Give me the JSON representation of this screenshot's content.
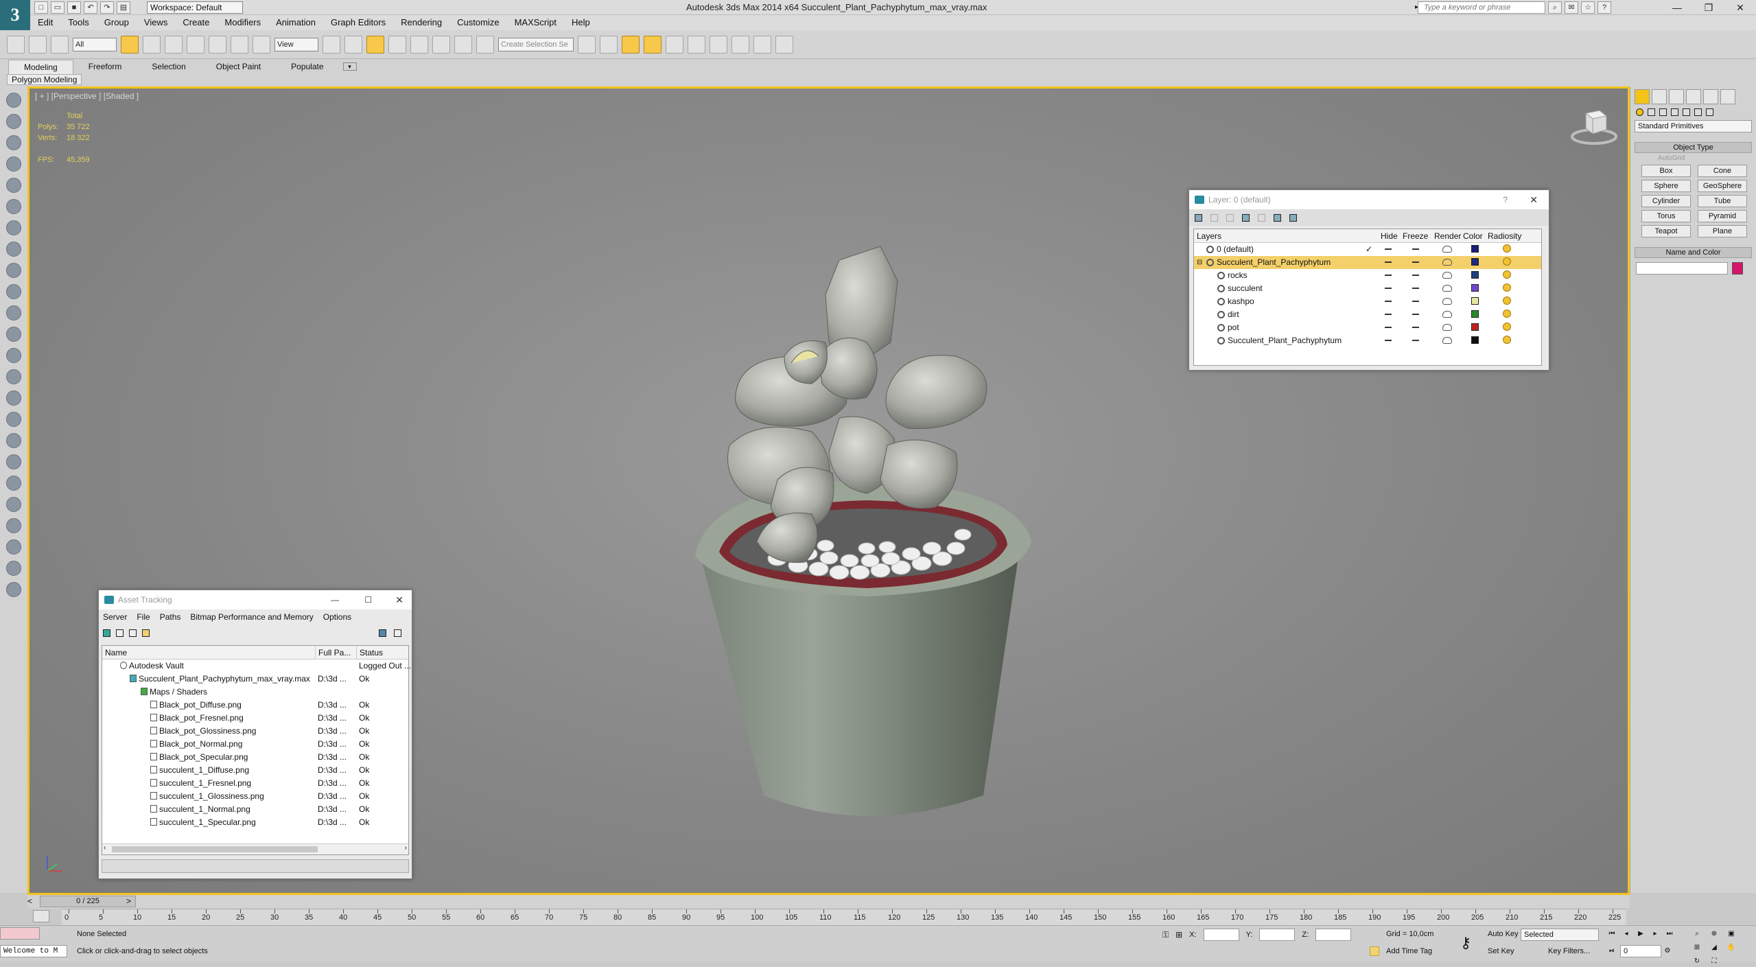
{
  "app": {
    "logo": "3",
    "workspace": "Workspace: Default",
    "title": "Autodesk 3ds Max  2014 x64     Succulent_Plant_Pachyphytum_max_vray.max",
    "search_placeholder": "Type a keyword or phrase"
  },
  "menus": [
    "Edit",
    "Tools",
    "Group",
    "Views",
    "Create",
    "Modifiers",
    "Animation",
    "Graph Editors",
    "Rendering",
    "Customize",
    "MAXScript",
    "Help"
  ],
  "toolbar": {
    "selection_filter": "All",
    "ref_coord": "View",
    "named_selection": "Create Selection Se"
  },
  "ribbon": {
    "tabs": [
      "Modeling",
      "Freeform",
      "Selection",
      "Object Paint",
      "Populate"
    ],
    "active_panel": "Polygon Modeling"
  },
  "viewport": {
    "label": "[ + ] [Perspective ] [Shaded ]",
    "stats_total": "Total",
    "polys_label": "Polys:",
    "polys_value": "35 722",
    "verts_label": "Verts:",
    "verts_value": "18 322",
    "fps_label": "FPS:",
    "fps_value": "45,359"
  },
  "command_panel": {
    "dropdown": "Standard Primitives",
    "object_type_title": "Object Type",
    "autogrid": "AutoGrid",
    "buttons": [
      "Box",
      "Cone",
      "Sphere",
      "GeoSphere",
      "Cylinder",
      "Tube",
      "Torus",
      "Pyramid",
      "Teapot",
      "Plane"
    ],
    "name_color_title": "Name and Color",
    "object_color": "#d6156a"
  },
  "layer_window": {
    "title": "Layer: 0 (default)",
    "columns": [
      "Layers",
      "Hide",
      "Freeze",
      "Render",
      "Color",
      "Radiosity"
    ],
    "rows": [
      {
        "name": "0 (default)",
        "color": "#1e1e7a"
      },
      {
        "name": "Succulent_Plant_Pachyphytum",
        "color": "#1e2a7a"
      },
      {
        "name": "rocks",
        "color": "#1e3f7a"
      },
      {
        "name": "succulent",
        "color": "#6a4ac8"
      },
      {
        "name": "kashpo",
        "color": "#e8e6a0"
      },
      {
        "name": "dirt",
        "color": "#2a8a2a"
      },
      {
        "name": "pot",
        "color": "#c02020"
      },
      {
        "name": "Succulent_Plant_Pachyphytum",
        "color": "#111111"
      }
    ]
  },
  "asset_window": {
    "title": "Asset Tracking",
    "menus": [
      "Server",
      "File",
      "Paths",
      "Bitmap Performance and Memory",
      "Options"
    ],
    "columns": [
      "Name",
      "Full Pa...",
      "Status"
    ],
    "rows": [
      {
        "name": "Autodesk Vault",
        "path": "",
        "status": "Logged Out ..."
      },
      {
        "name": "Succulent_Plant_Pachyphytum_max_vray.max",
        "path": "D:\\3d ...",
        "status": "Ok"
      },
      {
        "name": "Maps / Shaders",
        "path": "",
        "status": ""
      },
      {
        "name": "Black_pot_Diffuse.png",
        "path": "D:\\3d ...",
        "status": "Ok"
      },
      {
        "name": "Black_pot_Fresnel.png",
        "path": "D:\\3d ...",
        "status": "Ok"
      },
      {
        "name": "Black_pot_Glossiness.png",
        "path": "D:\\3d ...",
        "status": "Ok"
      },
      {
        "name": "Black_pot_Normal.png",
        "path": "D:\\3d ...",
        "status": "Ok"
      },
      {
        "name": "Black_pot_Specular.png",
        "path": "D:\\3d ...",
        "status": "Ok"
      },
      {
        "name": "succulent_1_Diffuse.png",
        "path": "D:\\3d ...",
        "status": "Ok"
      },
      {
        "name": "succulent_1_Fresnel.png",
        "path": "D:\\3d ...",
        "status": "Ok"
      },
      {
        "name": "succulent_1_Glossiness.png",
        "path": "D:\\3d ...",
        "status": "Ok"
      },
      {
        "name": "succulent_1_Normal.png",
        "path": "D:\\3d ...",
        "status": "Ok"
      },
      {
        "name": "succulent_1_Specular.png",
        "path": "D:\\3d ...",
        "status": "Ok"
      }
    ]
  },
  "timeline": {
    "frame": "0 / 225",
    "ticks": [
      "0",
      "5",
      "10",
      "15",
      "20",
      "25",
      "30",
      "35",
      "40",
      "45",
      "50",
      "55",
      "60",
      "65",
      "70",
      "75",
      "80",
      "85",
      "90",
      "95",
      "100",
      "105",
      "110",
      "115",
      "120",
      "125",
      "130",
      "135",
      "140",
      "145",
      "150",
      "155",
      "160",
      "165",
      "170",
      "175",
      "180",
      "185",
      "190",
      "195",
      "200",
      "205",
      "210",
      "215",
      "220",
      "225"
    ]
  },
  "status": {
    "welcome": "Welcome to M",
    "selection": "None Selected",
    "prompt": "Click or click-and-drag to select objects",
    "x_label": "X:",
    "y_label": "Y:",
    "z_label": "Z:",
    "grid": "Grid = 10,0cm",
    "add_time_tag": "Add Time Tag",
    "auto_key": "Auto Key",
    "set_key": "Set Key",
    "selected_dropdown": "Selected",
    "key_filters": "Key Filters...",
    "current_frame": "0"
  }
}
